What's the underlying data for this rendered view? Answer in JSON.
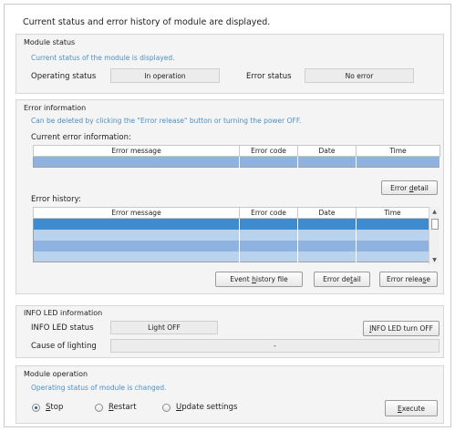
{
  "header": {
    "text": "Current status and error history of module are displayed."
  },
  "module_status": {
    "title": "Module status",
    "hint": "Current status of the module is displayed.",
    "operating_status_label": "Operating status",
    "operating_status_value": "In operation",
    "error_status_label": "Error status",
    "error_status_value": "No error"
  },
  "error_information": {
    "title": "Error information",
    "hint": "Can be deleted by clicking the \"Error release\" button or turning the power OFF.",
    "current_label": "Current error information:",
    "columns": [
      "Error message",
      "Error code",
      "Date",
      "Time"
    ],
    "error_detail_button": {
      "pre": "Error ",
      "key": "d",
      "post": "etail"
    },
    "history_label": "Error history:",
    "history_rows": 5,
    "event_history_button": {
      "pre": "Event ",
      "key": "h",
      "post": "istory file"
    },
    "error_detail_button2": {
      "pre": "Error de",
      "key": "t",
      "post": "ail"
    },
    "error_release_button": {
      "pre": "Error relea",
      "key": "s",
      "post": "e"
    }
  },
  "info_led": {
    "title": "INFO LED information",
    "status_label": "INFO LED status",
    "status_value": "Light OFF",
    "turn_off_button": {
      "pre": "",
      "key": "I",
      "post": "NFO LED turn OFF"
    },
    "cause_label": "Cause of lighting",
    "cause_value": "-"
  },
  "module_operation": {
    "title": "Module operation",
    "hint": "Operating status of module is changed.",
    "options": [
      {
        "pre": "",
        "key": "S",
        "post": "top",
        "selected": true
      },
      {
        "pre": "",
        "key": "R",
        "post": "estart",
        "selected": false
      },
      {
        "pre": "",
        "key": "U",
        "post": "pdate settings",
        "selected": false
      }
    ],
    "execute_button": {
      "pre": "",
      "key": "E",
      "post": "xecute"
    }
  }
}
